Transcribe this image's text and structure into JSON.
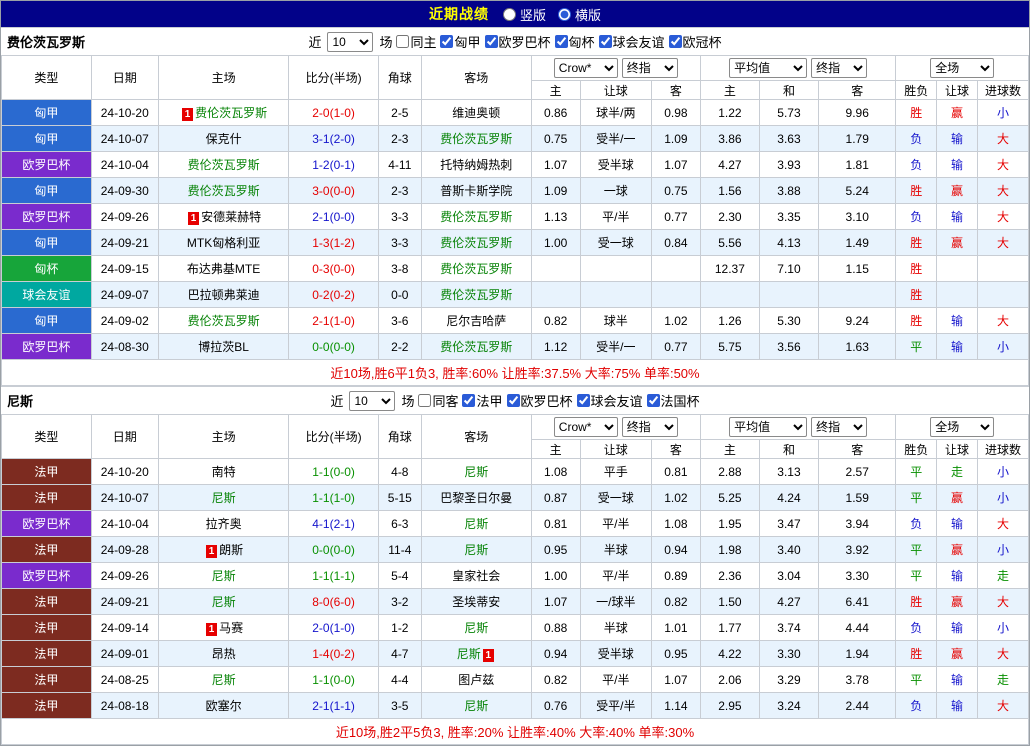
{
  "header": {
    "title": "近期战绩",
    "view_options": [
      {
        "label": "竖版",
        "selected": false
      },
      {
        "label": "横版",
        "selected": true
      }
    ]
  },
  "table_header": {
    "type": "类型",
    "date": "日期",
    "home": "主场",
    "score": "比分(半场)",
    "corner": "角球",
    "away": "客场",
    "odds_selects": [
      "Crow*",
      "终指"
    ],
    "odds_cols": [
      "主",
      "让球",
      "客"
    ],
    "avg_selects": [
      "平均值",
      "终指"
    ],
    "avg_cols": [
      "主",
      "和",
      "客"
    ],
    "full_selects": [
      "全场"
    ],
    "result_cols": [
      "胜负",
      "让球",
      "进球数"
    ]
  },
  "type_colors": {
    "匈甲": "#2a6ad0",
    "欧罗巴杯": "#7a2bcd",
    "匈杯": "#17a53a",
    "球会友谊": "#00a8a0",
    "法甲": "#7d2b20"
  },
  "sections": [
    {
      "team": "费伦茨瓦罗斯",
      "filter": {
        "near_label": "近",
        "count": "10",
        "games_label": "场",
        "same": {
          "label": "同主",
          "checked": false
        },
        "leagues": [
          {
            "label": "匈甲",
            "checked": true
          },
          {
            "label": "欧罗巴杯",
            "checked": true
          },
          {
            "label": "匈杯",
            "checked": true
          },
          {
            "label": "球会友谊",
            "checked": true
          },
          {
            "label": "欧冠杯",
            "checked": true
          }
        ]
      },
      "rows": [
        {
          "type": "匈甲",
          "date": "24-10-20",
          "home": {
            "name": "费伦茨瓦罗斯",
            "focus": true,
            "card": "1",
            "card_pos": "pre"
          },
          "score": "2-0(1-0)",
          "result": "win",
          "corner": "2-5",
          "away": {
            "name": "维迪奥顿",
            "focus": false
          },
          "odds": [
            "0.86",
            "球半/两",
            "0.98"
          ],
          "avg": [
            "1.22",
            "5.73",
            "9.96"
          ],
          "verdicts": [
            [
              "胜",
              "red"
            ],
            [
              "赢",
              "red"
            ],
            [
              "小",
              "blue"
            ]
          ]
        },
        {
          "type": "匈甲",
          "date": "24-10-07",
          "home": {
            "name": "保克什",
            "focus": false
          },
          "score": "3-1(2-0)",
          "result": "loss",
          "corner": "2-3",
          "away": {
            "name": "费伦茨瓦罗斯",
            "focus": true
          },
          "odds": [
            "0.75",
            "受半/一",
            "1.09"
          ],
          "avg": [
            "3.86",
            "3.63",
            "1.79"
          ],
          "verdicts": [
            [
              "负",
              "blue"
            ],
            [
              "输",
              "blue"
            ],
            [
              "大",
              "red"
            ]
          ]
        },
        {
          "type": "欧罗巴杯",
          "date": "24-10-04",
          "home": {
            "name": "费伦茨瓦罗斯",
            "focus": true
          },
          "score": "1-2(0-1)",
          "result": "loss",
          "corner": "4-11",
          "away": {
            "name": "托特纳姆热刺",
            "focus": false
          },
          "odds": [
            "1.07",
            "受半球",
            "1.07"
          ],
          "avg": [
            "4.27",
            "3.93",
            "1.81"
          ],
          "verdicts": [
            [
              "负",
              "blue"
            ],
            [
              "输",
              "blue"
            ],
            [
              "大",
              "red"
            ]
          ]
        },
        {
          "type": "匈甲",
          "date": "24-09-30",
          "home": {
            "name": "费伦茨瓦罗斯",
            "focus": true
          },
          "score": "3-0(0-0)",
          "result": "win",
          "corner": "2-3",
          "away": {
            "name": "普斯卡斯学院",
            "focus": false
          },
          "odds": [
            "1.09",
            "一球",
            "0.75"
          ],
          "avg": [
            "1.56",
            "3.88",
            "5.24"
          ],
          "verdicts": [
            [
              "胜",
              "red"
            ],
            [
              "赢",
              "red"
            ],
            [
              "大",
              "red"
            ]
          ]
        },
        {
          "type": "欧罗巴杯",
          "date": "24-09-26",
          "home": {
            "name": "安德莱赫特",
            "focus": false,
            "card": "1",
            "card_pos": "pre"
          },
          "score": "2-1(0-0)",
          "result": "loss",
          "corner": "3-3",
          "away": {
            "name": "费伦茨瓦罗斯",
            "focus": true
          },
          "odds": [
            "1.13",
            "平/半",
            "0.77"
          ],
          "avg": [
            "2.30",
            "3.35",
            "3.10"
          ],
          "verdicts": [
            [
              "负",
              "blue"
            ],
            [
              "输",
              "blue"
            ],
            [
              "大",
              "red"
            ]
          ]
        },
        {
          "type": "匈甲",
          "date": "24-09-21",
          "home": {
            "name": "MTK匈格利亚",
            "focus": false
          },
          "score": "1-3(1-2)",
          "result": "win",
          "corner": "3-3",
          "away": {
            "name": "费伦茨瓦罗斯",
            "focus": true
          },
          "odds": [
            "1.00",
            "受一球",
            "0.84"
          ],
          "avg": [
            "5.56",
            "4.13",
            "1.49"
          ],
          "verdicts": [
            [
              "胜",
              "red"
            ],
            [
              "赢",
              "red"
            ],
            [
              "大",
              "red"
            ]
          ]
        },
        {
          "type": "匈杯",
          "date": "24-09-15",
          "home": {
            "name": "布达弗基MTE",
            "focus": false
          },
          "score": "0-3(0-0)",
          "result": "win",
          "corner": "3-8",
          "away": {
            "name": "费伦茨瓦罗斯",
            "focus": true
          },
          "odds": [
            "",
            "",
            ""
          ],
          "avg": [
            "12.37",
            "7.10",
            "1.15"
          ],
          "verdicts": [
            [
              "胜",
              "red"
            ],
            [
              "",
              ""
            ],
            [
              "",
              ""
            ]
          ]
        },
        {
          "type": "球会友谊",
          "date": "24-09-07",
          "home": {
            "name": "巴拉顿弗莱迪",
            "focus": false
          },
          "score": "0-2(0-2)",
          "result": "win",
          "corner": "0-0",
          "away": {
            "name": "费伦茨瓦罗斯",
            "focus": true
          },
          "odds": [
            "",
            "",
            ""
          ],
          "avg": [
            "",
            "",
            ""
          ],
          "verdicts": [
            [
              "胜",
              "red"
            ],
            [
              "",
              ""
            ],
            [
              "",
              ""
            ]
          ]
        },
        {
          "type": "匈甲",
          "date": "24-09-02",
          "home": {
            "name": "费伦茨瓦罗斯",
            "focus": true
          },
          "score": "2-1(1-0)",
          "result": "win",
          "corner": "3-6",
          "away": {
            "name": "尼尔吉哈萨",
            "focus": false
          },
          "odds": [
            "0.82",
            "球半",
            "1.02"
          ],
          "avg": [
            "1.26",
            "5.30",
            "9.24"
          ],
          "verdicts": [
            [
              "胜",
              "red"
            ],
            [
              "输",
              "blue"
            ],
            [
              "大",
              "red"
            ]
          ]
        },
        {
          "type": "欧罗巴杯",
          "date": "24-08-30",
          "home": {
            "name": "博拉茨BL",
            "focus": false
          },
          "score": "0-0(0-0)",
          "result": "draw",
          "corner": "2-2",
          "away": {
            "name": "费伦茨瓦罗斯",
            "focus": true
          },
          "odds": [
            "1.12",
            "受半/一",
            "0.77"
          ],
          "avg": [
            "5.75",
            "3.56",
            "1.63"
          ],
          "verdicts": [
            [
              "平",
              "green"
            ],
            [
              "输",
              "blue"
            ],
            [
              "小",
              "blue"
            ]
          ]
        }
      ],
      "summary": "近10场,胜6平1负3, 胜率:60% 让胜率:37.5% 大率:75% 单率:50%"
    },
    {
      "team": "尼斯",
      "filter": {
        "near_label": "近",
        "count": "10",
        "games_label": "场",
        "same": {
          "label": "同客",
          "checked": false
        },
        "leagues": [
          {
            "label": "法甲",
            "checked": true
          },
          {
            "label": "欧罗巴杯",
            "checked": true
          },
          {
            "label": "球会友谊",
            "checked": true
          },
          {
            "label": "法国杯",
            "checked": true
          }
        ]
      },
      "rows": [
        {
          "type": "法甲",
          "date": "24-10-20",
          "home": {
            "name": "南特",
            "focus": false
          },
          "score": "1-1(0-0)",
          "result": "draw",
          "corner": "4-8",
          "away": {
            "name": "尼斯",
            "focus": true
          },
          "odds": [
            "1.08",
            "平手",
            "0.81"
          ],
          "avg": [
            "2.88",
            "3.13",
            "2.57"
          ],
          "verdicts": [
            [
              "平",
              "green"
            ],
            [
              "走",
              "green"
            ],
            [
              "小",
              "blue"
            ]
          ]
        },
        {
          "type": "法甲",
          "date": "24-10-07",
          "home": {
            "name": "尼斯",
            "focus": true
          },
          "score": "1-1(1-0)",
          "result": "draw",
          "corner": "5-15",
          "away": {
            "name": "巴黎圣日尔曼",
            "focus": false
          },
          "odds": [
            "0.87",
            "受一球",
            "1.02"
          ],
          "avg": [
            "5.25",
            "4.24",
            "1.59"
          ],
          "verdicts": [
            [
              "平",
              "green"
            ],
            [
              "赢",
              "red"
            ],
            [
              "小",
              "blue"
            ]
          ]
        },
        {
          "type": "欧罗巴杯",
          "date": "24-10-04",
          "home": {
            "name": "拉齐奥",
            "focus": false
          },
          "score": "4-1(2-1)",
          "result": "loss",
          "corner": "6-3",
          "away": {
            "name": "尼斯",
            "focus": true
          },
          "odds": [
            "0.81",
            "平/半",
            "1.08"
          ],
          "avg": [
            "1.95",
            "3.47",
            "3.94"
          ],
          "verdicts": [
            [
              "负",
              "blue"
            ],
            [
              "输",
              "blue"
            ],
            [
              "大",
              "red"
            ]
          ]
        },
        {
          "type": "法甲",
          "date": "24-09-28",
          "home": {
            "name": "朗斯",
            "focus": false,
            "card": "1",
            "card_pos": "pre"
          },
          "score": "0-0(0-0)",
          "result": "draw",
          "corner": "11-4",
          "away": {
            "name": "尼斯",
            "focus": true
          },
          "odds": [
            "0.95",
            "半球",
            "0.94"
          ],
          "avg": [
            "1.98",
            "3.40",
            "3.92"
          ],
          "verdicts": [
            [
              "平",
              "green"
            ],
            [
              "赢",
              "red"
            ],
            [
              "小",
              "blue"
            ]
          ]
        },
        {
          "type": "欧罗巴杯",
          "date": "24-09-26",
          "home": {
            "name": "尼斯",
            "focus": true
          },
          "score": "1-1(1-1)",
          "result": "draw",
          "corner": "5-4",
          "away": {
            "name": "皇家社会",
            "focus": false
          },
          "odds": [
            "1.00",
            "平/半",
            "0.89"
          ],
          "avg": [
            "2.36",
            "3.04",
            "3.30"
          ],
          "verdicts": [
            [
              "平",
              "green"
            ],
            [
              "输",
              "blue"
            ],
            [
              "走",
              "green"
            ]
          ]
        },
        {
          "type": "法甲",
          "date": "24-09-21",
          "home": {
            "name": "尼斯",
            "focus": true
          },
          "score": "8-0(6-0)",
          "result": "win",
          "corner": "3-2",
          "away": {
            "name": "圣埃蒂安",
            "focus": false
          },
          "odds": [
            "1.07",
            "一/球半",
            "0.82"
          ],
          "avg": [
            "1.50",
            "4.27",
            "6.41"
          ],
          "verdicts": [
            [
              "胜",
              "red"
            ],
            [
              "赢",
              "red"
            ],
            [
              "大",
              "red"
            ]
          ]
        },
        {
          "type": "法甲",
          "date": "24-09-14",
          "home": {
            "name": "马赛",
            "focus": false,
            "card": "1",
            "card_pos": "pre"
          },
          "score": "2-0(1-0)",
          "result": "loss",
          "corner": "1-2",
          "away": {
            "name": "尼斯",
            "focus": true
          },
          "odds": [
            "0.88",
            "半球",
            "1.01"
          ],
          "avg": [
            "1.77",
            "3.74",
            "4.44"
          ],
          "verdicts": [
            [
              "负",
              "blue"
            ],
            [
              "输",
              "blue"
            ],
            [
              "小",
              "blue"
            ]
          ]
        },
        {
          "type": "法甲",
          "date": "24-09-01",
          "home": {
            "name": "昂热",
            "focus": false
          },
          "score": "1-4(0-2)",
          "result": "win",
          "corner": "4-7",
          "away": {
            "name": "尼斯",
            "focus": true,
            "card": "1",
            "card_pos": "post"
          },
          "odds": [
            "0.94",
            "受半球",
            "0.95"
          ],
          "avg": [
            "4.22",
            "3.30",
            "1.94"
          ],
          "verdicts": [
            [
              "胜",
              "red"
            ],
            [
              "赢",
              "red"
            ],
            [
              "大",
              "red"
            ]
          ]
        },
        {
          "type": "法甲",
          "date": "24-08-25",
          "home": {
            "name": "尼斯",
            "focus": true
          },
          "score": "1-1(0-0)",
          "result": "draw",
          "corner": "4-4",
          "away": {
            "name": "图卢兹",
            "focus": false
          },
          "odds": [
            "0.82",
            "平/半",
            "1.07"
          ],
          "avg": [
            "2.06",
            "3.29",
            "3.78"
          ],
          "verdicts": [
            [
              "平",
              "green"
            ],
            [
              "输",
              "blue"
            ],
            [
              "走",
              "green"
            ]
          ]
        },
        {
          "type": "法甲",
          "date": "24-08-18",
          "home": {
            "name": "欧塞尔",
            "focus": false
          },
          "score": "2-1(1-1)",
          "result": "loss",
          "corner": "3-5",
          "away": {
            "name": "尼斯",
            "focus": true
          },
          "odds": [
            "0.76",
            "受平/半",
            "1.14"
          ],
          "avg": [
            "2.95",
            "3.24",
            "2.44"
          ],
          "verdicts": [
            [
              "负",
              "blue"
            ],
            [
              "输",
              "blue"
            ],
            [
              "大",
              "red"
            ]
          ]
        }
      ],
      "summary": "近10场,胜2平5负3, 胜率:20% 让胜率:40% 大率:40% 单率:30%"
    }
  ]
}
